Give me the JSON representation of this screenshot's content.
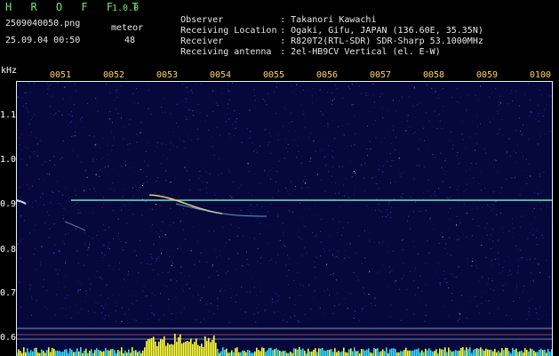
{
  "app": {
    "name": "H R O F F T",
    "version": "1.0.0"
  },
  "file": {
    "name": "2509040050.png",
    "datetime": "25.09.04 00:50"
  },
  "meteor": {
    "label": "meteor",
    "count": "48"
  },
  "info": [
    {
      "label": "Observer",
      "value": ": Takanori Kawachi"
    },
    {
      "label": "Receiving Location",
      "value": ": Ogaki, Gifu, JAPAN (136.60E, 35.35N)"
    },
    {
      "label": "Receiver",
      "value": ": R820T2(RTL-SDR) SDR-Sharp 53.1000MHz"
    },
    {
      "label": "Receiving antenna",
      "value": ": 2el-HB9CV Vertical (el. E-W)"
    }
  ],
  "spectrogram": {
    "y_unit": "kHz",
    "y_ticks": [
      "1.1",
      "1.0",
      "0.9",
      "0.8",
      "0.7",
      "0.6"
    ],
    "x_ticks": [
      "0051",
      "0052",
      "0053",
      "0054",
      "0055",
      "0056",
      "0057",
      "0058",
      "0059",
      "0100"
    ],
    "colors": {
      "background": "#06073a",
      "carrier": "#7dffd0",
      "level": "#ffff33",
      "axis": "#f0f0f0",
      "tick_label": "#ffd35a"
    }
  }
}
